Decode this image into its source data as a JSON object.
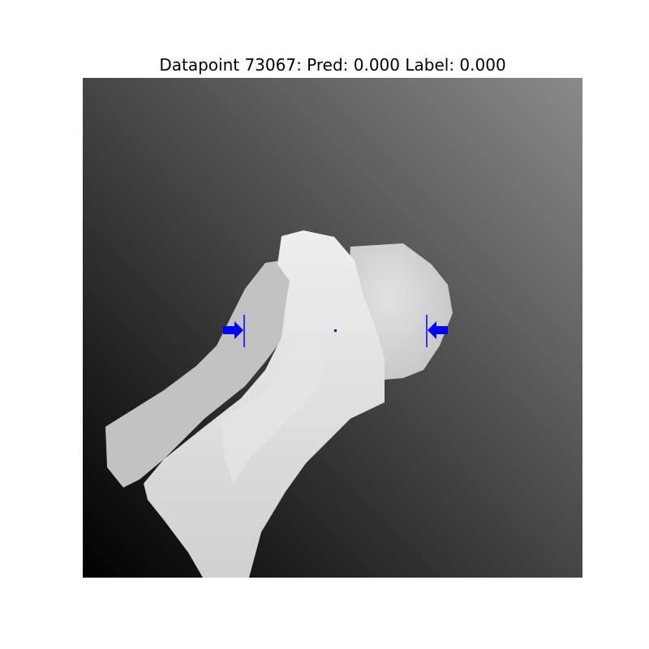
{
  "figure": {
    "title": "Datapoint 73067: Pred: 0.000 Label: 0.000",
    "image_description_icon": "depth-image",
    "grasp_color": "#0000ff"
  }
}
